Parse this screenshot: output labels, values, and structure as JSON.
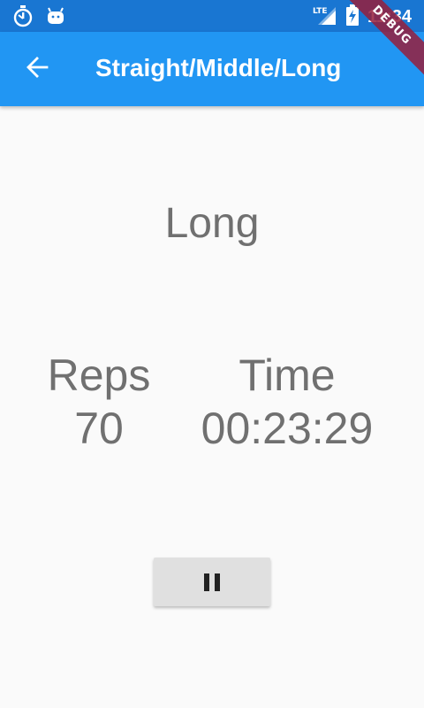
{
  "status_bar": {
    "time": "11:34",
    "network": "LTE",
    "icons": [
      "stopwatch-icon",
      "android-icon",
      "lte-signal-icon",
      "battery-charging-icon"
    ]
  },
  "app_bar": {
    "title": "Straight/Middle/Long",
    "back_icon": "arrow-back-icon"
  },
  "debug_banner": "DEBUG",
  "workout": {
    "phase": "Long",
    "reps_label": "Reps",
    "reps_value": "70",
    "time_label": "Time",
    "time_value": "00:23:29"
  },
  "controls": {
    "pause_icon": "pause-icon"
  },
  "colors": {
    "status_bar": "#1976d2",
    "app_bar": "#2196f3",
    "background": "#fafafa",
    "text": "#707070",
    "button": "#e0e0e0"
  }
}
